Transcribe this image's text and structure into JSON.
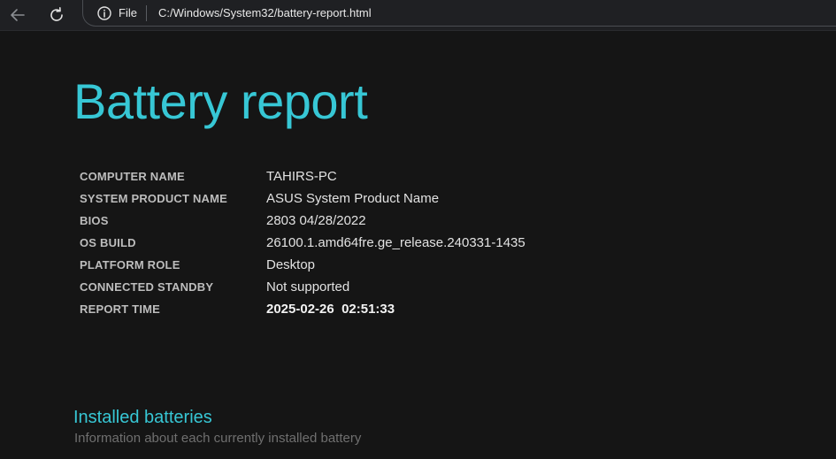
{
  "browser": {
    "scheme_label": "File",
    "url": "C:/Windows/System32/battery-report.html"
  },
  "report": {
    "title": "Battery report",
    "system_info": [
      {
        "label": "COMPUTER NAME",
        "value": "TAHIRS-PC"
      },
      {
        "label": "SYSTEM PRODUCT NAME",
        "value": "ASUS System Product Name"
      },
      {
        "label": "BIOS",
        "value": "2803 04/28/2022"
      },
      {
        "label": "OS BUILD",
        "value": "26100.1.amd64fre.ge_release.240331-1435"
      },
      {
        "label": "PLATFORM ROLE",
        "value": "Desktop"
      },
      {
        "label": "CONNECTED STANDBY",
        "value": "Not supported"
      },
      {
        "label": "REPORT TIME",
        "value": "2025-02-26  02:51:33"
      }
    ],
    "installed_batteries": {
      "heading": "Installed batteries",
      "description": "Information about each currently installed battery"
    }
  },
  "colors": {
    "accent": "#37c7d5",
    "background": "#151515",
    "toolbar": "#1f2023"
  }
}
